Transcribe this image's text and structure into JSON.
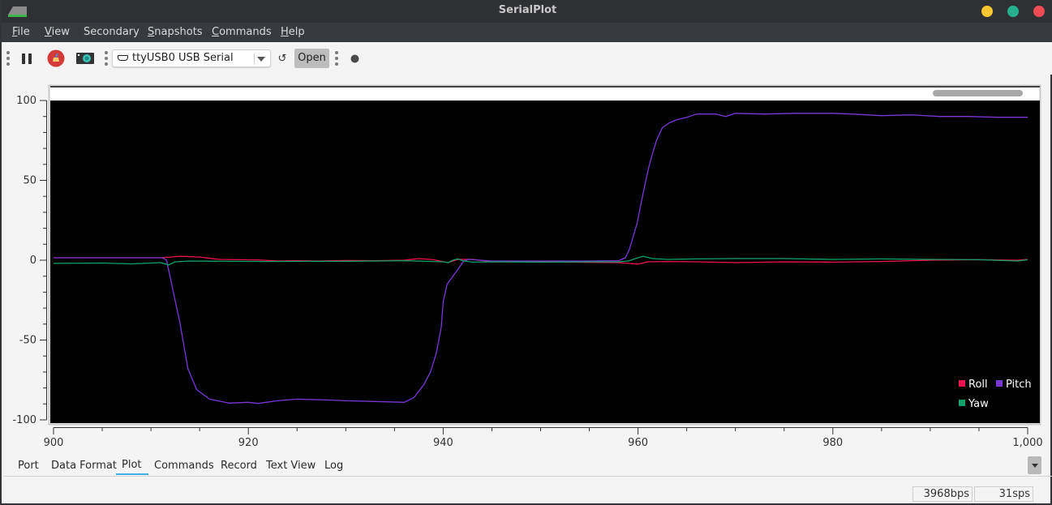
{
  "window": {
    "title": "SerialPlot",
    "buttons": [
      {
        "name": "minimize",
        "color": "#f8c630"
      },
      {
        "name": "maximize",
        "color": "#26b08e"
      },
      {
        "name": "close",
        "color": "#ee4b55"
      }
    ]
  },
  "menu": [
    {
      "label": "File",
      "mnemonic": "F",
      "rest": "ile"
    },
    {
      "label": "View",
      "mnemonic": "V",
      "rest": "iew"
    },
    {
      "label": "Secondary",
      "mnemonic": "",
      "rest": "Secondary"
    },
    {
      "label": "Snapshots",
      "mnemonic": "S",
      "rest": "napshots"
    },
    {
      "label": "Commands",
      "mnemonic": "C",
      "rest": "ommands"
    },
    {
      "label": "Help",
      "mnemonic": "H",
      "rest": "elp"
    }
  ],
  "toolbar": {
    "pause_icon": "pause-icon",
    "clear_icon": "broom-clear-icon",
    "snapshot_icon": "camera-icon",
    "port_selected": "ttyUSB0 USB Serial",
    "port_icon": "serial-port-icon",
    "refresh_glyph": "↺",
    "open_label": "Open",
    "status_icon": "connection-status-dot"
  },
  "tabs": [
    {
      "label": "Port",
      "active": false
    },
    {
      "label": "Data Format",
      "active": false
    },
    {
      "label": "Plot",
      "active": true
    },
    {
      "label": "Commands",
      "active": false
    },
    {
      "label": "Record",
      "active": false
    },
    {
      "label": "Text View",
      "active": false
    },
    {
      "label": "Log",
      "active": false
    }
  ],
  "status": {
    "bps": "3968bps",
    "sps": "31sps"
  },
  "chart_data": {
    "type": "line",
    "title": "",
    "xlabel": "",
    "ylabel": "",
    "xlim": [
      900,
      1000
    ],
    "ylim": [
      -100,
      100
    ],
    "xticks": [
      900,
      920,
      940,
      960,
      980,
      1000
    ],
    "xtick_labels": [
      "900",
      "920",
      "940",
      "960",
      "980",
      "1,000"
    ],
    "yticks": [
      100,
      50,
      0,
      -50,
      -100
    ],
    "ytick_labels": [
      "100",
      "50",
      "0",
      "-50",
      "-100"
    ],
    "background": "#000000",
    "grid": false,
    "legend": {
      "placement": "bottom-right",
      "entries": [
        "Roll",
        "Pitch",
        "Yaw"
      ]
    },
    "series": [
      {
        "name": "Roll",
        "color": "#f0124f",
        "points": [
          [
            900,
            1.5
          ],
          [
            905,
            1.5
          ],
          [
            911,
            1.5
          ],
          [
            912,
            2
          ],
          [
            913,
            2.5
          ],
          [
            915,
            2
          ],
          [
            917,
            0.5
          ],
          [
            919,
            0.3
          ],
          [
            921,
            0.2
          ],
          [
            923,
            -0.5
          ],
          [
            925,
            -0.3
          ],
          [
            927,
            -0.5
          ],
          [
            930,
            -0.2
          ],
          [
            933,
            -0.3
          ],
          [
            936,
            0
          ],
          [
            937.5,
            1
          ],
          [
            939,
            0.3
          ],
          [
            940.5,
            -1.5
          ],
          [
            941.5,
            0.5
          ],
          [
            943,
            0.5
          ],
          [
            945,
            -1
          ],
          [
            950,
            -1
          ],
          [
            955,
            -1.3
          ],
          [
            958,
            -1.5
          ],
          [
            959,
            -2
          ],
          [
            960,
            -2.5
          ],
          [
            961,
            -1
          ],
          [
            963,
            -0.8
          ],
          [
            966,
            -1
          ],
          [
            970,
            -1.5
          ],
          [
            975,
            -1
          ],
          [
            980,
            -1.2
          ],
          [
            985,
            -0.8
          ],
          [
            990,
            0
          ],
          [
            995,
            0.3
          ],
          [
            999,
            0
          ],
          [
            1000,
            0.5
          ]
        ]
      },
      {
        "name": "Pitch",
        "color": "#7b36d8",
        "points": [
          [
            900,
            1.5
          ],
          [
            905,
            1.5
          ],
          [
            911.2,
            1.5
          ],
          [
            911.6,
            0
          ],
          [
            912.2,
            -17
          ],
          [
            913,
            -40
          ],
          [
            913.8,
            -68
          ],
          [
            914.7,
            -81
          ],
          [
            916,
            -87
          ],
          [
            918,
            -89.5
          ],
          [
            920,
            -89
          ],
          [
            921,
            -89.7
          ],
          [
            923,
            -88
          ],
          [
            925,
            -87
          ],
          [
            928,
            -87.5
          ],
          [
            930,
            -88
          ],
          [
            933,
            -88.5
          ],
          [
            936,
            -89
          ],
          [
            937,
            -86
          ],
          [
            938,
            -78
          ],
          [
            938.7,
            -70
          ],
          [
            939.3,
            -58
          ],
          [
            939.8,
            -42
          ],
          [
            940,
            -26
          ],
          [
            940.4,
            -15
          ],
          [
            941,
            -10
          ],
          [
            941.6,
            -5
          ],
          [
            942.1,
            -0.5
          ],
          [
            942.6,
            0.5
          ],
          [
            945,
            -0.5
          ],
          [
            950,
            -0.5
          ],
          [
            955,
            -0.5
          ],
          [
            958,
            -0.3
          ],
          [
            958.7,
            1.5
          ],
          [
            959.1,
            6.5
          ],
          [
            959.5,
            14.7
          ],
          [
            959.9,
            23
          ],
          [
            960.3,
            35
          ],
          [
            960.7,
            47
          ],
          [
            961.1,
            58
          ],
          [
            961.5,
            67
          ],
          [
            961.9,
            75
          ],
          [
            962.5,
            83
          ],
          [
            963.2,
            86
          ],
          [
            964,
            88
          ],
          [
            965,
            89.5
          ],
          [
            966,
            91.5
          ],
          [
            968,
            91.5
          ],
          [
            969,
            90
          ],
          [
            970,
            92
          ],
          [
            973,
            91.5
          ],
          [
            976,
            92
          ],
          [
            980,
            92
          ],
          [
            982,
            91.5
          ],
          [
            985,
            90.5
          ],
          [
            988,
            91
          ],
          [
            991,
            90
          ],
          [
            994,
            90
          ],
          [
            997,
            89.5
          ],
          [
            1000,
            89.5
          ]
        ]
      },
      {
        "name": "Yaw",
        "color": "#0fa26a",
        "points": [
          [
            900,
            -2
          ],
          [
            905,
            -1.8
          ],
          [
            908,
            -2.3
          ],
          [
            911,
            -1.5
          ],
          [
            911.8,
            -3
          ],
          [
            912.5,
            -1
          ],
          [
            914,
            -0.5
          ],
          [
            918,
            -0.7
          ],
          [
            922,
            -0.8
          ],
          [
            926,
            -0.7
          ],
          [
            930,
            -0.7
          ],
          [
            936,
            -0.3
          ],
          [
            939,
            -0.8
          ],
          [
            940,
            -1
          ],
          [
            940.5,
            -1.5
          ],
          [
            941,
            0
          ],
          [
            941.5,
            0.8
          ],
          [
            942,
            -0.3
          ],
          [
            943,
            -1.2
          ],
          [
            945,
            -1
          ],
          [
            950,
            -1.2
          ],
          [
            955,
            -1
          ],
          [
            958,
            -1
          ],
          [
            959,
            -0.5
          ],
          [
            960,
            1.5
          ],
          [
            960.5,
            2.5
          ],
          [
            961.5,
            1
          ],
          [
            963,
            0.5
          ],
          [
            966,
            0.8
          ],
          [
            970,
            1
          ],
          [
            975,
            1
          ],
          [
            980,
            0.5
          ],
          [
            985,
            0.8
          ],
          [
            990,
            0.5
          ],
          [
            995,
            0.3
          ],
          [
            999,
            -0.5
          ],
          [
            1000,
            0.3
          ]
        ]
      }
    ]
  }
}
